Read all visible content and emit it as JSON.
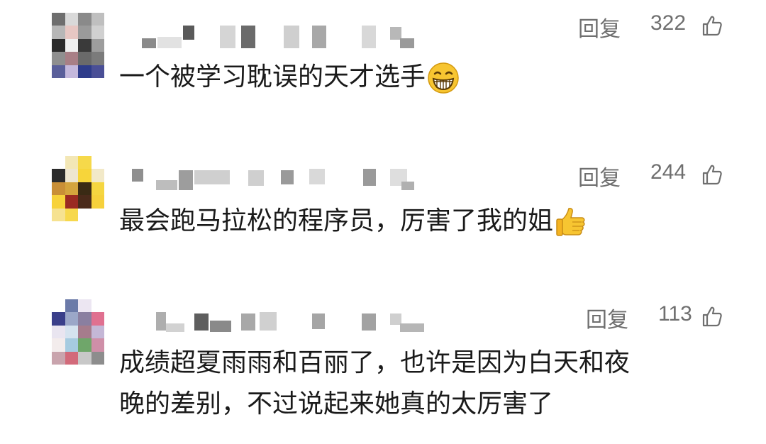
{
  "comments": [
    {
      "text": "一个被学习耽误的天才选手",
      "reply_label": "回复",
      "likes": "322",
      "emoji": "grinning-face-emoji"
    },
    {
      "text": "最会跑马拉松的程序员，厉害了我的姐",
      "reply_label": "回复",
      "likes": "244",
      "emoji": "thumbs-up-emoji"
    },
    {
      "text_line1": "成绩超夏雨雨和百丽了，也许是因为白天和夜",
      "text_line2": "晚的差别，不过说起来她真的太厉害了",
      "reply_label": "回复",
      "likes": "113"
    }
  ],
  "colors": {
    "text": "#1a1a1a",
    "meta": "#6f6f6f",
    "background": "#ffffff"
  }
}
